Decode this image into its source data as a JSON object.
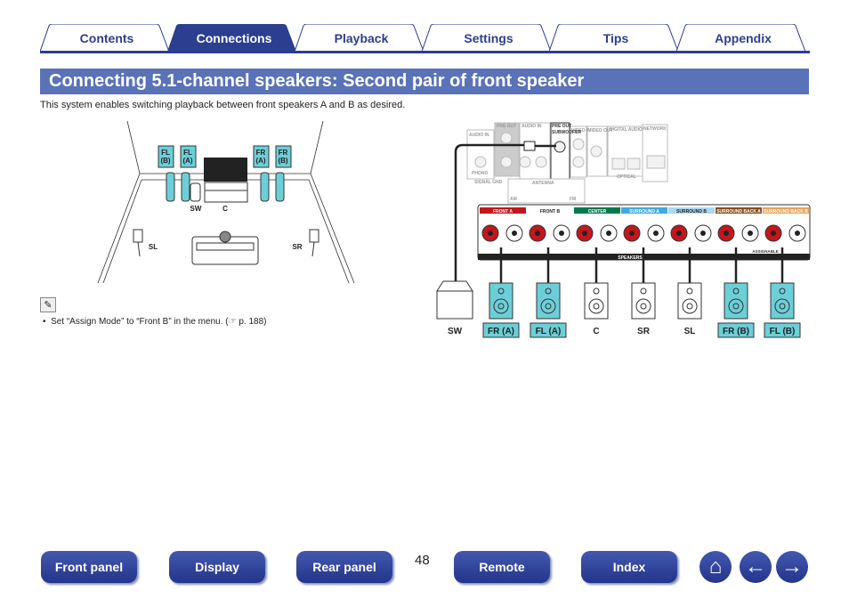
{
  "tabs": [
    {
      "label": "Contents"
    },
    {
      "label": "Connections",
      "active": true
    },
    {
      "label": "Playback"
    },
    {
      "label": "Settings"
    },
    {
      "label": "Tips"
    },
    {
      "label": "Appendix"
    }
  ],
  "title": "Connecting 5.1-channel speakers: Second pair of front speaker",
  "intro": "This system enables switching playback between front speakers A and B as desired.",
  "room": {
    "labels": {
      "fl_b": [
        "FL",
        "(B)"
      ],
      "fl_a": [
        "FL",
        "(A)"
      ],
      "fr_a": [
        "FR",
        "(A)"
      ],
      "fr_b": [
        "FR",
        "(B)"
      ],
      "sw": "SW",
      "c": "C",
      "sl": "SL",
      "sr": "SR"
    }
  },
  "note": {
    "icon": "pencil-icon",
    "text": "Set “Assign Mode” to “Front B” in the menu.  (☞ p. 188)"
  },
  "rear_panel": {
    "top_labels": [
      "AUDIO IN",
      "PRE OUT",
      "AUDIO IN",
      "PRE OUT",
      "VIDEO IN",
      "VIDEO OUT",
      "DIGITAL AUDIO",
      "NETWORK",
      "ANTENNA",
      "PHONO",
      "SIGNAL GND",
      "OPTICAL",
      "AM",
      "FM",
      "SUBWOOFER"
    ],
    "channels": [
      {
        "label": "FRONT A",
        "color": "#c4161c"
      },
      {
        "label": "FRONT B",
        "color": "#ffffff"
      },
      {
        "label": "CENTER",
        "color": "#007a4d"
      },
      {
        "label": "SURROUND A",
        "color": "#3fa9e0"
      },
      {
        "label": "SURROUND B",
        "color": "#a9d8f2"
      },
      {
        "label": "SURROUND BACK A",
        "color": "#8a4b1c"
      },
      {
        "label": "SURROUND BACK B",
        "color": "#e6a35a"
      }
    ],
    "speakers_label": "SPEAKERS",
    "assignable_label": "ASSIGNABLE"
  },
  "speakers": [
    {
      "label": "SW"
    },
    {
      "label": "FR (A)",
      "highlight": true
    },
    {
      "label": "FL (A)",
      "highlight": true
    },
    {
      "label": "C"
    },
    {
      "label": "SR"
    },
    {
      "label": "SL"
    },
    {
      "label": "FR (B)",
      "highlight": true
    },
    {
      "label": "FL (B)",
      "highlight": true
    }
  ],
  "footer": {
    "buttons": [
      "Front panel",
      "Display",
      "Rear panel",
      "Remote",
      "Index"
    ],
    "page": "48",
    "home_icon": "home-icon",
    "back_icon": "arrow-left-icon",
    "forward_icon": "arrow-right-icon"
  },
  "colors": {
    "accent": "#2c3e8f",
    "title_bg": "#5a72b7",
    "speaker_highlight": "#6ccfd8"
  }
}
